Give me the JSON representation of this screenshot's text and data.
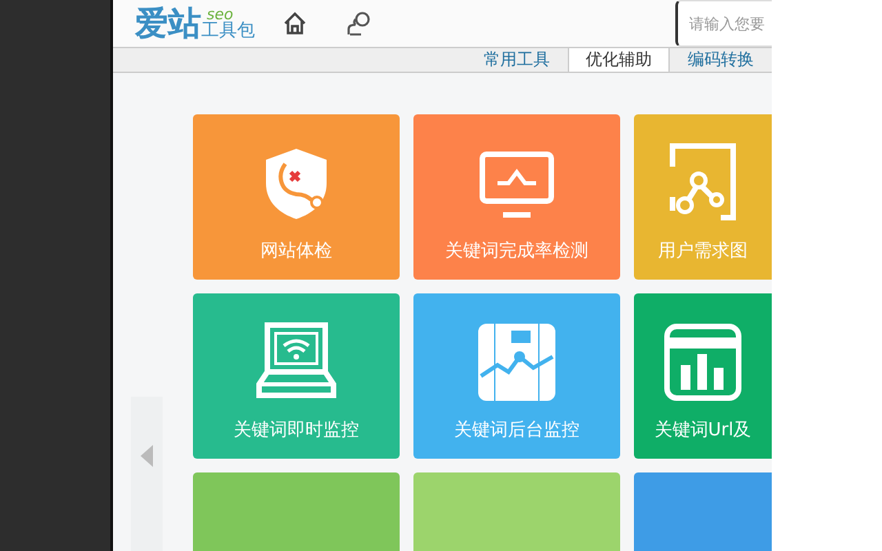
{
  "logo": {
    "main": "爱站",
    "sup": "seo",
    "sub": "工具包"
  },
  "search": {
    "placeholder": "请输入您要"
  },
  "tabs": [
    {
      "label": "常用工具",
      "selected": false
    },
    {
      "label": "优化辅助",
      "selected": true
    },
    {
      "label": "编码转换",
      "selected": false
    }
  ],
  "tiles": [
    {
      "label": "网站体检",
      "color": "#f7963a"
    },
    {
      "label": "关键词完成率检测",
      "color": "#fd824a"
    },
    {
      "label": "用户需求图",
      "color": "#e8b631"
    },
    {
      "label": "关键词即时监控",
      "color": "#27bb8e"
    },
    {
      "label": "关键词后台监控",
      "color": "#42b2ee"
    },
    {
      "label": "关键词Url及",
      "color": "#0fae67"
    },
    {
      "color": "#7fc65a"
    },
    {
      "color": "#9cd46c"
    },
    {
      "color": "#3e9ce6"
    }
  ]
}
